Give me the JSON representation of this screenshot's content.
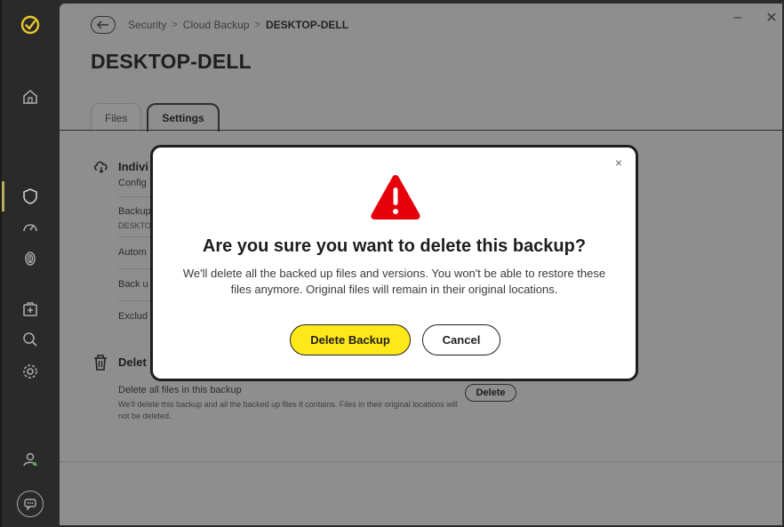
{
  "breadcrumb": {
    "item1": "Security",
    "item2": "Cloud Backup",
    "current": "DESKTOP-DELL"
  },
  "page": {
    "title": "DESKTOP-DELL"
  },
  "tabs": [
    {
      "label": "Files"
    },
    {
      "label": "Settings"
    }
  ],
  "settings": {
    "section1_title": "Indivi",
    "section1_sub": "Config",
    "row1_label": "Backup",
    "row1_sub": "DESKTO",
    "row2_label": "Autom",
    "row3_label": "Back u",
    "row4_label": "Exclud",
    "section2_title": "Delet",
    "delete_all_label": "Delete all files in this backup",
    "delete_all_desc": "We'll delete this backup and all the backed up files it contains. Files in their original locations will not be deleted.",
    "delete_button": "Delete"
  },
  "modal": {
    "title": "Are you sure you want to delete this backup?",
    "body": "We'll delete all the backed up files and versions. You won't be able to restore these files anymore. Original files will remain in their original locations.",
    "confirm_button": "Delete Backup",
    "cancel_button": "Cancel",
    "close_glyph": "×"
  },
  "window": {
    "minimize_glyph": "–",
    "close_glyph": "✕"
  },
  "colors": {
    "accent": "#ffe81a",
    "warning": "#e5000a",
    "sidebar": "#2a2a2a"
  }
}
